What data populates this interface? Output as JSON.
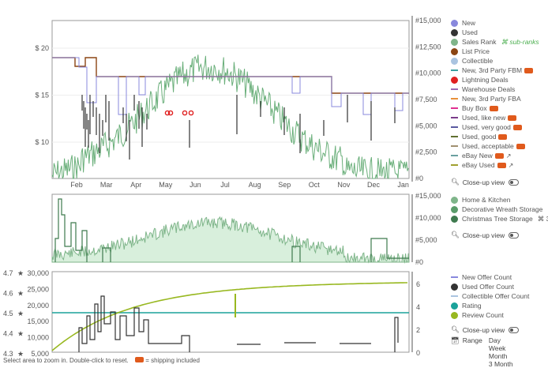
{
  "price_chart": {
    "left_ticks": [
      {
        "value": 20,
        "label": "$ 20"
      },
      {
        "value": 15,
        "label": "$ 15"
      },
      {
        "value": 10,
        "label": "$ 10"
      }
    ],
    "right_ticks": [
      "#15,000",
      "#12,500",
      "#10,000",
      "#7,500",
      "#5,000",
      "#2,500",
      "#0"
    ],
    "months": [
      "Feb",
      "Mar",
      "Apr",
      "May",
      "Jun",
      "Jul",
      "Aug",
      "Sep",
      "Oct",
      "Nov",
      "Dec",
      "Jan"
    ],
    "colors": {
      "new": "#8888dd",
      "list": "#8b4513",
      "rank": "#6aaf7a",
      "used": "#333333",
      "red": "#e02020"
    }
  },
  "rank_chart": {
    "right_ticks": [
      "#15,000",
      "#10,000",
      "#5,000",
      "#0"
    ]
  },
  "offers_chart": {
    "left_ticks": [
      "30,000",
      "25,000",
      "20,000",
      "15,000",
      "10,000",
      "5,000"
    ],
    "rating_ticks": [
      "4.7",
      "4.6",
      "4.5",
      "4.4",
      "4.3"
    ],
    "right_ticks": [
      "6",
      "4",
      "2",
      "0"
    ]
  },
  "legend1": [
    {
      "label": "New",
      "color": "#8888dd",
      "kind": "dot"
    },
    {
      "label": "Used",
      "color": "#333333",
      "kind": "dot"
    },
    {
      "label": "Sales Rank",
      "color": "#7fb58a",
      "kind": "dot",
      "extra": "sub-ranks"
    },
    {
      "label": "List Price",
      "color": "#8b4513",
      "kind": "dot"
    },
    {
      "label": "Collectible",
      "color": "#aac4e0",
      "kind": "dot"
    },
    {
      "label": "New, 3rd Party FBM",
      "color": "#3aa0a0",
      "kind": "dash",
      "truck": true
    },
    {
      "label": "Lightning Deals",
      "color": "#e02020",
      "kind": "dot"
    },
    {
      "label": "Warehouse Deals",
      "color": "#9a6ab5",
      "kind": "dash"
    },
    {
      "label": "New, 3rd Party FBA",
      "color": "#e8903a",
      "kind": "dash"
    },
    {
      "label": "Buy Box",
      "color": "#e03090",
      "kind": "dash",
      "truck": true
    },
    {
      "label": "Used, like new",
      "color": "#7a3b8a",
      "kind": "dash",
      "truck": true
    },
    {
      "label": "Used, very good",
      "color": "#5a5aa0",
      "kind": "dash",
      "truck": true
    },
    {
      "label": "Used, good",
      "color": "#607030",
      "kind": "dash",
      "truck": true
    },
    {
      "label": "Used, acceptable",
      "color": "#a09070",
      "kind": "dash",
      "truck": true
    },
    {
      "label": "eBay New",
      "color": "#6aa0a0",
      "kind": "dash",
      "truck": true,
      "link": true
    },
    {
      "label": "eBay Used",
      "color": "#a0a030",
      "kind": "dash",
      "truck": true,
      "link": true
    }
  ],
  "closeup_label": "Close-up view",
  "legend2": [
    {
      "label": "Home & Kitchen",
      "color": "#7fb58a"
    },
    {
      "label": "Decorative Wreath Storage",
      "color": "#5a9c6a"
    },
    {
      "label": "Christmas Tree Storage",
      "color": "#3e7a4e",
      "extra": "3"
    }
  ],
  "legend3": [
    {
      "label": "New Offer Count",
      "color": "#8888dd",
      "kind": "dash"
    },
    {
      "label": "Used Offer Count",
      "color": "#333333",
      "kind": "dot"
    },
    {
      "label": "Collectible Offer Count",
      "color": "#aac4e0",
      "kind": "dash"
    },
    {
      "label": "Rating",
      "color": "#1aa29a",
      "kind": "dot"
    },
    {
      "label": "Review Count",
      "color": "#98b820",
      "kind": "dot"
    }
  ],
  "range": {
    "label": "Range",
    "options": [
      "Day",
      "Week",
      "Month",
      "3 Month"
    ]
  },
  "footer": {
    "text": "Select area to zoom in. Double-click to reset.",
    "shipping": "= shipping included"
  }
}
